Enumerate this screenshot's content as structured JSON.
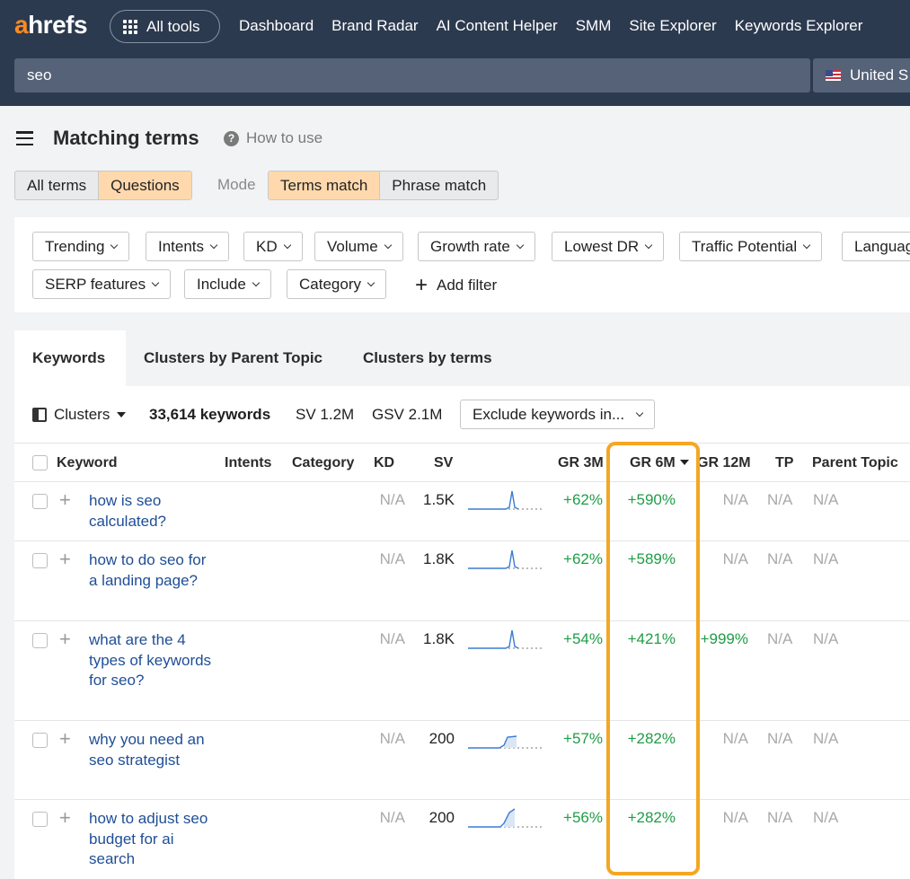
{
  "nav": {
    "logo_a": "a",
    "logo_rest": "hrefs",
    "all_tools": "All tools",
    "links": [
      "Dashboard",
      "Brand Radar",
      "AI Content Helper",
      "SMM",
      "Site Explorer",
      "Keywords Explorer"
    ],
    "search_value": "seo",
    "country": "United S"
  },
  "header": {
    "title": "Matching terms",
    "how_to_use": "How to use",
    "q_glyph": "?"
  },
  "term_types": [
    "All terms",
    "Questions"
  ],
  "mode_label": "Mode",
  "modes": [
    "Terms match",
    "Phrase match"
  ],
  "filters": {
    "row1": [
      "Trending",
      "Intents",
      "KD",
      "Volume",
      "Growth rate",
      "Lowest DR",
      "Traffic Potential",
      "Languag"
    ],
    "row2": [
      "SERP features",
      "Include",
      "Category"
    ],
    "add_filter": "Add filter",
    "plus_glyph": "+"
  },
  "tabs": [
    "Keywords",
    "Clusters by Parent Topic",
    "Clusters by terms"
  ],
  "toolbar": {
    "clusters": "Clusters",
    "keyword_count": "33,614 keywords",
    "sv": "SV 1.2M",
    "gsv": "GSV 2.1M",
    "exclude": "Exclude keywords in..."
  },
  "columns": [
    "Keyword",
    "Intents",
    "Category",
    "KD",
    "SV",
    "GR 3M",
    "GR 6M",
    "GR 12M",
    "TP",
    "Parent Topic"
  ],
  "rows": [
    {
      "keyword": "how is seo calculated?",
      "kd": "N/A",
      "sv": "1.5K",
      "gr3m": "+62%",
      "gr6m": "+590%",
      "gr12m": "N/A",
      "tp": "N/A",
      "parent": "N/A",
      "trend": "spike"
    },
    {
      "keyword": "how to do seo for a landing page?",
      "kd": "N/A",
      "sv": "1.8K",
      "gr3m": "+62%",
      "gr6m": "+589%",
      "gr12m": "N/A",
      "tp": "N/A",
      "parent": "N/A",
      "trend": "spike"
    },
    {
      "keyword": "what are the 4 types of keywords for seo?",
      "kd": "N/A",
      "sv": "1.8K",
      "gr3m": "+54%",
      "gr6m": "+421%",
      "gr12m": "+999%",
      "tp": "N/A",
      "parent": "N/A",
      "trend": "spike"
    },
    {
      "keyword": "why you need an seo strategist",
      "kd": "N/A",
      "sv": "200",
      "gr3m": "+57%",
      "gr6m": "+282%",
      "gr12m": "N/A",
      "tp": "N/A",
      "parent": "N/A",
      "trend": "step"
    },
    {
      "keyword": "how to adjust seo budget for ai search",
      "kd": "N/A",
      "sv": "200",
      "gr3m": "+56%",
      "gr6m": "+282%",
      "gr12m": "N/A",
      "tp": "N/A",
      "parent": "N/A",
      "trend": "rise"
    }
  ],
  "colors": {
    "nav_bg": "#2c3a4f",
    "accent_orange": "#ff8a1e",
    "selected_segment": "#ffd9ad",
    "positive_green": "#1f9d46",
    "link_blue": "#1f4e96",
    "highlight_border": "#f5a623"
  }
}
